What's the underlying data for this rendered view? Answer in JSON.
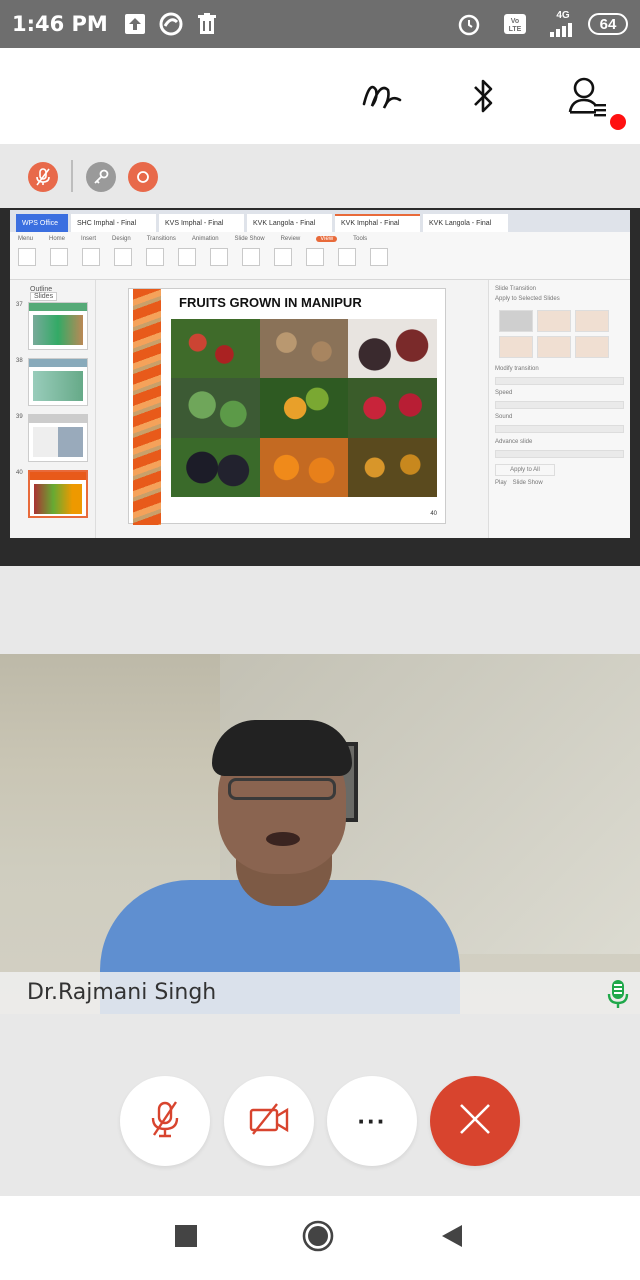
{
  "status_bar": {
    "time": "1:46 PM",
    "network_label_top": "4G",
    "volte_label": "Vo LTE",
    "battery_level": "64",
    "icons": [
      "upload-icon",
      "sync-icon",
      "trash-icon",
      "alarm-icon",
      "volte-icon",
      "signal-icon",
      "battery-icon"
    ]
  },
  "app_bar": {
    "icons": [
      "annotate-icon",
      "bluetooth-icon",
      "participants-icon"
    ],
    "notification_dot_color": "#ff1010"
  },
  "meeting_controls": {
    "icons": [
      "muted-mic-icon",
      "key-icon",
      "record-icon"
    ],
    "accent_color": "#e8694a"
  },
  "shared_screen": {
    "app_tabs": [
      "WPS Office",
      "SHC Imphal - Final",
      "KVS Imphal - Final",
      "KVK Langola - Final",
      "KVK Imphal - Final",
      "KVK Langola - Final"
    ],
    "ribbon_menu": [
      "Menu",
      "Home",
      "Insert",
      "Design",
      "Transitions",
      "Animation",
      "Slide Show",
      "Review",
      "View",
      "Tools"
    ],
    "left_panel_tabs": [
      "Outline",
      "Slides"
    ],
    "slide_numbers": [
      "37",
      "38",
      "39",
      "40"
    ],
    "slide": {
      "title": "FRUITS  GROWN IN MANIPUR",
      "page_number": "40"
    },
    "right_panel_title": "Slide Transition",
    "right_panel_labels": [
      "Apply to Selected Slides",
      "Modify transition",
      "Speed",
      "Sound",
      "Advance slide",
      "Apply to All",
      "Play",
      "Slide Show"
    ]
  },
  "video": {
    "participant_name": "Dr.Rajmani Singh",
    "mic_active_color": "#1fa84a"
  },
  "call_controls": {
    "buttons": [
      "mute-button",
      "video-off-button",
      "more-button",
      "end-call-button"
    ],
    "more_label": "···",
    "end_color": "#d8442e"
  },
  "nav_bar": {
    "items": [
      "recents-button",
      "home-button",
      "back-button"
    ]
  }
}
